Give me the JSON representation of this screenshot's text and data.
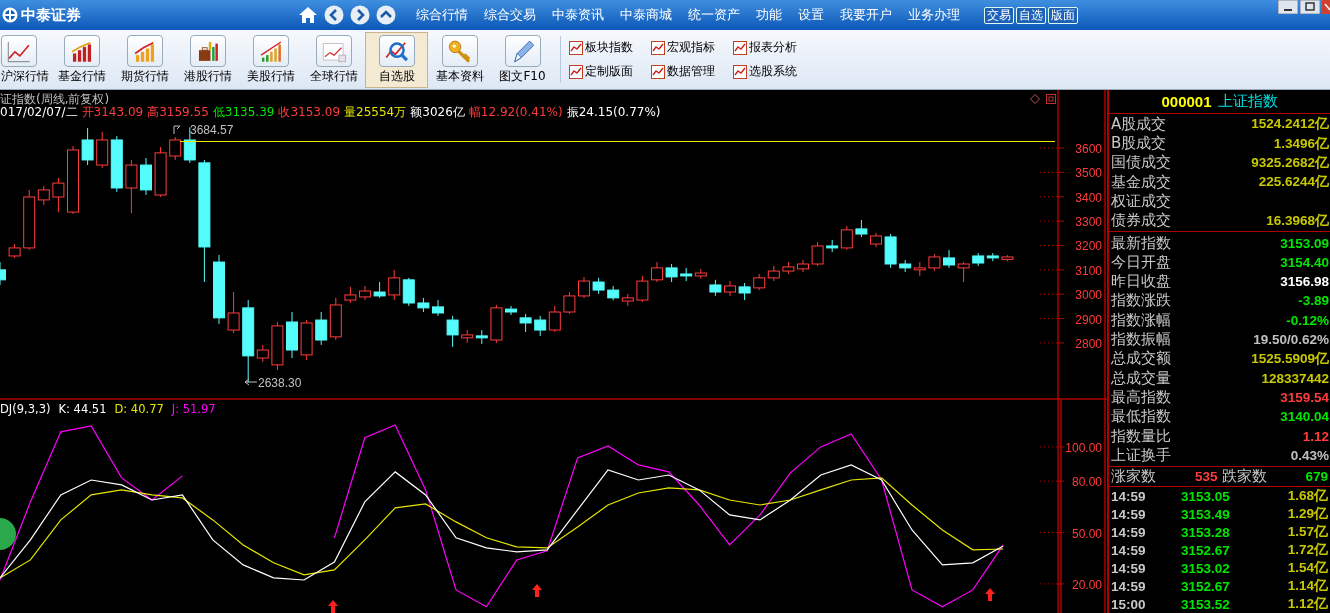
{
  "titlebar": {
    "logo": "中泰证券",
    "menu": [
      "综合行情",
      "综合交易",
      "中泰资讯",
      "中泰商城",
      "统一资产",
      "功能",
      "设置",
      "我要开户",
      "业务办理"
    ],
    "buttons": [
      "交易",
      "自选",
      "版面"
    ]
  },
  "toolbar": {
    "buttons": [
      {
        "label": "沪深行情",
        "selected": false
      },
      {
        "label": "基金行情",
        "selected": false
      },
      {
        "label": "期货行情",
        "selected": false
      },
      {
        "label": "港股行情",
        "selected": false
      },
      {
        "label": "美股行情",
        "selected": false
      },
      {
        "label": "全球行情",
        "selected": false
      },
      {
        "label": "自选股",
        "selected": true
      },
      {
        "label": "基本资料",
        "selected": false
      },
      {
        "label": "图文F10",
        "selected": false
      }
    ],
    "links": [
      "板块指数",
      "宏观指标",
      "报表分析",
      "定制版面",
      "数据管理",
      "选股系统"
    ]
  },
  "chart": {
    "title": "证指数(周线,前复权)",
    "info": [
      {
        "text": "017/02/07/二",
        "color": "#ffffff"
      },
      {
        "text": "开3143.09",
        "color": "#ff3c3c"
      },
      {
        "text": "高3159.55",
        "color": "#ff3c3c"
      },
      {
        "text": "低3135.39",
        "color": "#00e600"
      },
      {
        "text": "收3153.09",
        "color": "#ff3c3c"
      },
      {
        "text": "量25554万",
        "color": "#e6e600"
      },
      {
        "text": "额3026亿",
        "color": "#ffffff"
      },
      {
        "text": "幅12.92(0.41%)",
        "color": "#ff3c3c"
      },
      {
        "text": "振24.15(0.77%)",
        "color": "#ffffff"
      }
    ],
    "high_label": "3684.57",
    "low_label": "2638.30",
    "chart_data": {
      "type": "candlestick",
      "ylim": [
        2570,
        3838
      ],
      "yticks": [
        3600,
        3500,
        3400,
        3300,
        3200,
        3100,
        3000,
        2900,
        2800
      ],
      "ohlc": [
        [
          3100,
          3132,
          3038,
          3059
        ],
        [
          3157,
          3206,
          3149,
          3190
        ],
        [
          3190,
          3428,
          3182,
          3399
        ],
        [
          3387,
          3444,
          3366,
          3428
        ],
        [
          3399,
          3477,
          3337,
          3456
        ],
        [
          3337,
          3608,
          3329,
          3592
        ],
        [
          3633,
          3682,
          3530,
          3551
        ],
        [
          3530,
          3666,
          3518,
          3633
        ],
        [
          3633,
          3649,
          3420,
          3436
        ],
        [
          3436,
          3551,
          3333,
          3530
        ],
        [
          3530,
          3559,
          3407,
          3428
        ],
        [
          3407,
          3604,
          3399,
          3580
        ],
        [
          3567,
          3645,
          3551,
          3633
        ],
        [
          3633,
          3685,
          3539,
          3551
        ],
        [
          3539,
          3551,
          3050,
          3194
        ],
        [
          3132,
          3161,
          2878,
          2903
        ],
        [
          2853,
          3009,
          2841,
          2923
        ],
        [
          2944,
          2976,
          2638,
          2747
        ],
        [
          2738,
          2792,
          2722,
          2771
        ],
        [
          2710,
          2886,
          2689,
          2870
        ],
        [
          2886,
          2927,
          2738,
          2771
        ],
        [
          2751,
          2894,
          2730,
          2882
        ],
        [
          2894,
          2927,
          2792,
          2812
        ],
        [
          2825,
          2985,
          2812,
          2956
        ],
        [
          2976,
          3030,
          2964,
          2997
        ],
        [
          2989,
          3034,
          2976,
          3013
        ],
        [
          3009,
          3050,
          2985,
          2993
        ],
        [
          2997,
          3100,
          2976,
          3067
        ],
        [
          3059,
          3067,
          2952,
          2964
        ],
        [
          2964,
          2985,
          2927,
          2944
        ],
        [
          2948,
          2976,
          2911,
          2923
        ],
        [
          2894,
          2911,
          2784,
          2833
        ],
        [
          2821,
          2853,
          2800,
          2833
        ],
        [
          2829,
          2853,
          2796,
          2821
        ],
        [
          2812,
          2956,
          2800,
          2944
        ],
        [
          2939,
          2952,
          2915,
          2927
        ],
        [
          2903,
          2919,
          2845,
          2882
        ],
        [
          2894,
          2911,
          2829,
          2853
        ],
        [
          2853,
          2952,
          2845,
          2927
        ],
        [
          2927,
          3009,
          2919,
          2993
        ],
        [
          2993,
          3071,
          2985,
          3054
        ],
        [
          3050,
          3067,
          3001,
          3017
        ],
        [
          3017,
          3034,
          2975,
          2985
        ],
        [
          2972,
          3001,
          2952,
          2985
        ],
        [
          2976,
          3075,
          2968,
          3054
        ],
        [
          3059,
          3132,
          3050,
          3108
        ],
        [
          3108,
          3124,
          3050,
          3071
        ],
        [
          3083,
          3108,
          3054,
          3075
        ],
        [
          3075,
          3104,
          3063,
          3087
        ],
        [
          3038,
          3059,
          2993,
          3009
        ],
        [
          3009,
          3054,
          2993,
          3034
        ],
        [
          3030,
          3046,
          2976,
          3005
        ],
        [
          3026,
          3083,
          3017,
          3067
        ],
        [
          3067,
          3116,
          3054,
          3095
        ],
        [
          3095,
          3132,
          3083,
          3112
        ],
        [
          3104,
          3140,
          3091,
          3124
        ],
        [
          3124,
          3214,
          3116,
          3198
        ],
        [
          3198,
          3223,
          3173,
          3190
        ],
        [
          3190,
          3280,
          3182,
          3264
        ],
        [
          3268,
          3305,
          3235,
          3247
        ],
        [
          3206,
          3251,
          3194,
          3239
        ],
        [
          3235,
          3247,
          3108,
          3124
        ],
        [
          3124,
          3140,
          3091,
          3108
        ],
        [
          3100,
          3132,
          3075,
          3108
        ],
        [
          3108,
          3165,
          3095,
          3153
        ],
        [
          3149,
          3182,
          3108,
          3120
        ],
        [
          3108,
          3132,
          3050,
          3124
        ],
        [
          3157,
          3169,
          3116,
          3128
        ],
        [
          3157,
          3169,
          3136,
          3149
        ],
        [
          3143,
          3160,
          3135,
          3153
        ]
      ]
    },
    "indicator": {
      "legend": [
        {
          "text": "DJ(9,3,3)",
          "color": "#ffffff"
        },
        {
          "text": ": 44.51",
          "color": "#ffffff"
        },
        {
          "text": ": 40.77",
          "color": "#e6e600"
        },
        {
          "text": ": 51.97",
          "color": "#ff00ff"
        }
      ],
      "chart_data": {
        "type": "line",
        "ylim": [
          3,
          127.4
        ],
        "yticks": [
          {
            "value": 100,
            "label": "100.00"
          },
          {
            "value": 80,
            "label": "80.00"
          },
          {
            "value": 50,
            "label": "50.00"
          },
          {
            "value": 20,
            "label": "20.00"
          }
        ],
        "series": [
          {
            "name": "K",
            "color": "#ffffff",
            "values": [
              23.5,
              45.7,
              72,
              80.7,
              77.8,
              69,
              72,
              45.7,
              31.1,
              23.5,
              22.3,
              32.8,
              67.9,
              85.4,
              72,
              46.9,
              41,
              38.7,
              39.9,
              63.2,
              86.6,
              80.7,
              83.6,
              74.9,
              60.3,
              57.4,
              69,
              83.6,
              89.5,
              80.7,
              51.5,
              31.1,
              32.3,
              42.2
            ]
          },
          {
            "name": "D",
            "color": "#e6e600",
            "values": [
              23.5,
              34,
              57.4,
              72,
              74.9,
              72,
              70.2,
              57.4,
              42.8,
              32.3,
              25.3,
              28.2,
              45.7,
              64.4,
              66.7,
              56.2,
              46.9,
              41.6,
              41,
              53.3,
              66.1,
              73.1,
              76.1,
              74.9,
              69,
              66.1,
              69,
              74.9,
              80.7,
              81.9,
              66.1,
              51.5,
              39.9,
              40.4
            ]
          },
          {
            "name": "J",
            "color": "#ff00ff",
            "values": [
              22.3,
              67.9,
              108.8,
              112.3,
              81.9,
              69,
              83.1,
              null,
              null,
              null,
              null,
              46.9,
              105.3,
              112.8,
              74.9,
              16.5,
              6.6,
              34,
              39.3,
              93.6,
              100.6,
              89.5,
              85.4,
              66.1,
              42.8,
              60.3,
              84.8,
              100,
              107.6,
              80.7,
              16.5,
              6.6,
              16.5,
              42.8
            ]
          }
        ]
      }
    }
  },
  "quote": {
    "code": "000001",
    "name": "上证指数",
    "sections": [
      [
        {
          "label": "A股成交",
          "value": "1524.2412亿",
          "color": "#c8c800"
        },
        {
          "label": "B股成交",
          "value": "1.3496亿",
          "color": "#c8c800"
        },
        {
          "label": "国债成交",
          "value": "9325.2682亿",
          "color": "#c8c800"
        },
        {
          "label": "基金成交",
          "value": "225.6244亿",
          "color": "#c8c800"
        },
        {
          "label": "权证成交"
        },
        {
          "label": "债券成交",
          "value": "16.3968亿",
          "color": "#c8c800"
        }
      ],
      [
        {
          "label": "最新指数",
          "value": "3153.09",
          "color": "#00e600"
        },
        {
          "label": "今日开盘",
          "value": "3154.40",
          "color": "#00e600"
        },
        {
          "label": "昨日收盘",
          "value": "3156.98",
          "color": "#ffffff"
        },
        {
          "label": "指数涨跌",
          "value": "-3.89",
          "color": "#00e600"
        },
        {
          "label": "指数涨幅",
          "value": "-0.12%",
          "color": "#00e600"
        },
        {
          "label": "指数振幅",
          "value": "19.50/0.62%",
          "color": "#c0c0c0"
        },
        {
          "label": "总成交额",
          "value": "1525.5909亿",
          "color": "#c8c800"
        },
        {
          "label": "总成交量",
          "value": "128337442",
          "color": "#c8c800"
        },
        {
          "label": "最高指数",
          "value": "3159.54",
          "color": "#ff3c3c"
        },
        {
          "label": "最低指数",
          "value": "3140.04",
          "color": "#00e600"
        },
        {
          "label": "指数量比",
          "value": "1.12",
          "color": "#ff3c3c"
        },
        {
          "label": "上证换手",
          "value": "0.43%",
          "color": "#c0c0c0"
        }
      ]
    ],
    "breadth": {
      "up_label": "涨家数",
      "up": "535",
      "down_label": "跌家数",
      "down": "679"
    },
    "ticks": [
      {
        "time": "14:59",
        "price": "3153.05",
        "volume": "1.68亿"
      },
      {
        "time": "14:59",
        "price": "3153.49",
        "volume": "1.29亿"
      },
      {
        "time": "14:59",
        "price": "3153.28",
        "volume": "1.57亿"
      },
      {
        "time": "14:59",
        "price": "3152.67",
        "volume": "1.72亿"
      },
      {
        "time": "14:59",
        "price": "3153.02",
        "volume": "1.54亿"
      },
      {
        "time": "14:59",
        "price": "3152.67",
        "volume": "1.14亿"
      },
      {
        "time": "15:00",
        "price": "3153.52",
        "volume": "1.12亿"
      }
    ]
  }
}
